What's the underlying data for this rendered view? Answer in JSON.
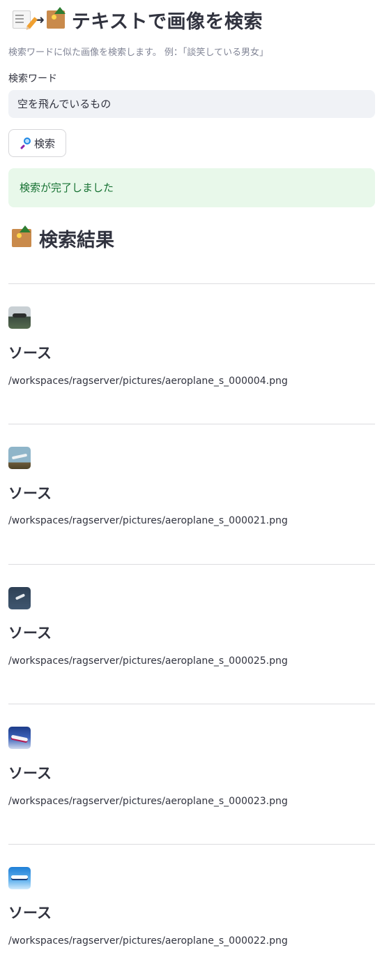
{
  "page": {
    "title": "テキストで画像を検索",
    "title_icons": [
      "memo-icon",
      "arrow-right-icon",
      "framed-picture-icon"
    ],
    "description": "検索ワードに似た画像を検索します。 例：「談笑している男女」"
  },
  "search": {
    "label": "検索ワード",
    "value": "空を飛んでいるもの",
    "button_label": "検索",
    "button_icon": "magnifying-glass-icon"
  },
  "status": {
    "message": "検索が完了しました",
    "color": "#177233",
    "background": "#e8f8ea"
  },
  "results_section": {
    "title": "検索結果",
    "icon": "framed-picture-icon"
  },
  "results": [
    {
      "heading": "ソース",
      "path": "/workspaces/ragserver/pictures/aeroplane_s_000004.png"
    },
    {
      "heading": "ソース",
      "path": "/workspaces/ragserver/pictures/aeroplane_s_000021.png"
    },
    {
      "heading": "ソース",
      "path": "/workspaces/ragserver/pictures/aeroplane_s_000025.png"
    },
    {
      "heading": "ソース",
      "path": "/workspaces/ragserver/pictures/aeroplane_s_000023.png"
    },
    {
      "heading": "ソース",
      "path": "/workspaces/ragserver/pictures/aeroplane_s_000022.png"
    }
  ]
}
